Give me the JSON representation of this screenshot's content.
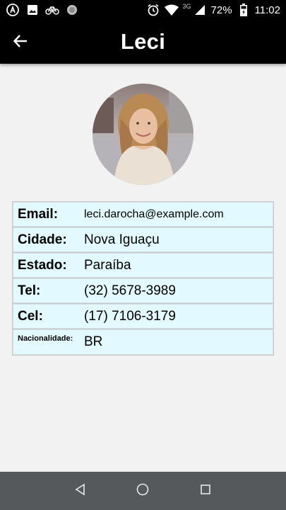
{
  "status_bar": {
    "network": "3G",
    "battery": "72%",
    "time": "11:02",
    "icons_left": [
      "app-icon",
      "image-icon",
      "bike-icon",
      "circle-icon"
    ],
    "icons_right": [
      "alarm-icon",
      "wifi-icon",
      "signal-icon",
      "battery-icon"
    ]
  },
  "app_bar": {
    "title": "Leci",
    "back_icon": "arrow-left-icon"
  },
  "profile": {
    "fields": [
      {
        "label": "Email:",
        "value": "leci.darocha@example.com"
      },
      {
        "label": "Cidade:",
        "value": "Nova Iguaçu"
      },
      {
        "label": "Estado:",
        "value": "Paraíba"
      },
      {
        "label": "Tel:",
        "value": "(32) 5678-3989"
      },
      {
        "label": "Cel:",
        "value": "(17) 7106-3179"
      },
      {
        "label": "Nacionalidade:",
        "value": "BR"
      }
    ]
  },
  "nav_bar": {
    "icons": [
      "back-triangle-icon",
      "home-circle-icon",
      "recents-square-icon"
    ]
  },
  "colors": {
    "app_bar": "#000000",
    "row_background": "#e1f9ff",
    "nav_bar": "#55595c",
    "page_background": "#f2f2f2"
  }
}
